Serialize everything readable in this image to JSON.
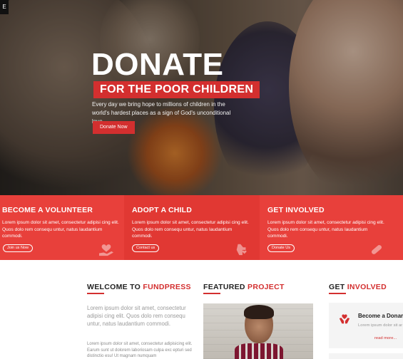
{
  "hero": {
    "corner_label": "E",
    "title": "DONATE",
    "subtitle": "FOR THE POOR CHILDREN",
    "text": "Every day we bring hope to millions of children in the world's hardest places as a sign of God's unconditional love.",
    "button": "Donate Now"
  },
  "band": {
    "columns": [
      {
        "title": "BECOME A VOLUNTEER",
        "text": "Lorem ipsum dolor sit amet, consectetur adipisi cing elit. Quos dolo rem consequ untur, natus laudantium commodi.",
        "button": "Join us Now",
        "icon": "heart-hand-icon"
      },
      {
        "title": "ADOPT A CHILD",
        "text": "Lorem ipsum dolor sit amet, consectetur adipisi cing elit. Quos dolo rem consequ untur, natus laudantium commodi.",
        "button": "Contact us",
        "icon": "hand-heart-icon"
      },
      {
        "title": "GET INVOLVED",
        "text": "Lorem ipsum dolor sit amet, consectetur adipisi cing elit. Quos dolo rem consequ untur, natus laudantium commodi.",
        "button": "Donate Us",
        "icon": "bandage-icon"
      }
    ]
  },
  "welcome": {
    "title_prefix": "WELCOME TO ",
    "title_highlight": "FUNDPRESS",
    "lead": "Lorem ipsum dolor sit amet, consectetur adipisi cing elit. Quos dolo rem consequ untur, natus laudantium commodi.",
    "small": "Lorem ipsum dolor sit amet, consectetur adipisicing elit. Earum sunt ut dolorem laboriosam culpa exc epturi sed distinctio esu! Ut magnam numquam"
  },
  "featured": {
    "title_prefix": "FEATURED ",
    "title_highlight": "PROJECT"
  },
  "involved": {
    "title_prefix": "GET ",
    "title_highlight": "INVOLVED",
    "card_title": "Become a Donar",
    "card_text": "Lorem ipsum dolor sit am elit sectetu radipisicing quasi.",
    "card_link": "read more..."
  },
  "colors": {
    "accent": "#d32f2f",
    "band": "#e53935"
  }
}
